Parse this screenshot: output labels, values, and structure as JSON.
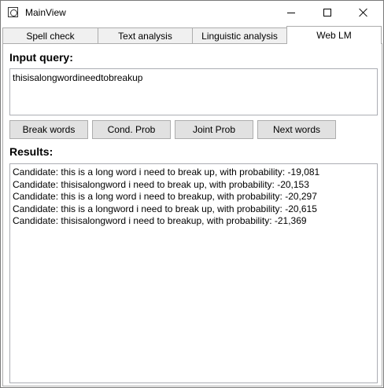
{
  "window": {
    "title": "MainView"
  },
  "tabs": [
    {
      "label": "Spell check",
      "active": false
    },
    {
      "label": "Text analysis",
      "active": false
    },
    {
      "label": "Linguistic analysis",
      "active": false
    },
    {
      "label": "Web LM",
      "active": true
    }
  ],
  "input": {
    "label": "Input query:",
    "value": "thisisalongwordineedtobreakup"
  },
  "buttons": {
    "break_words": "Break words",
    "cond_prob": "Cond. Prob",
    "joint_prob": "Joint Prob",
    "next_words": "Next words"
  },
  "results": {
    "label": "Results:",
    "lines": [
      "Candidate: this is a long word i need to break up, with probability: -19,081",
      "Candidate: thisisalongword i need to break up, with probability: -20,153",
      "Candidate: this is a long word i need to breakup, with probability: -20,297",
      "Candidate: this is a longword i need to break up, with probability: -20,615",
      "Candidate: thisisalongword i need to breakup, with probability: -21,369"
    ]
  },
  "icons": {
    "app": "app-window-icon",
    "minimize": "minimize-icon",
    "maximize": "maximize-icon",
    "close": "close-icon"
  }
}
